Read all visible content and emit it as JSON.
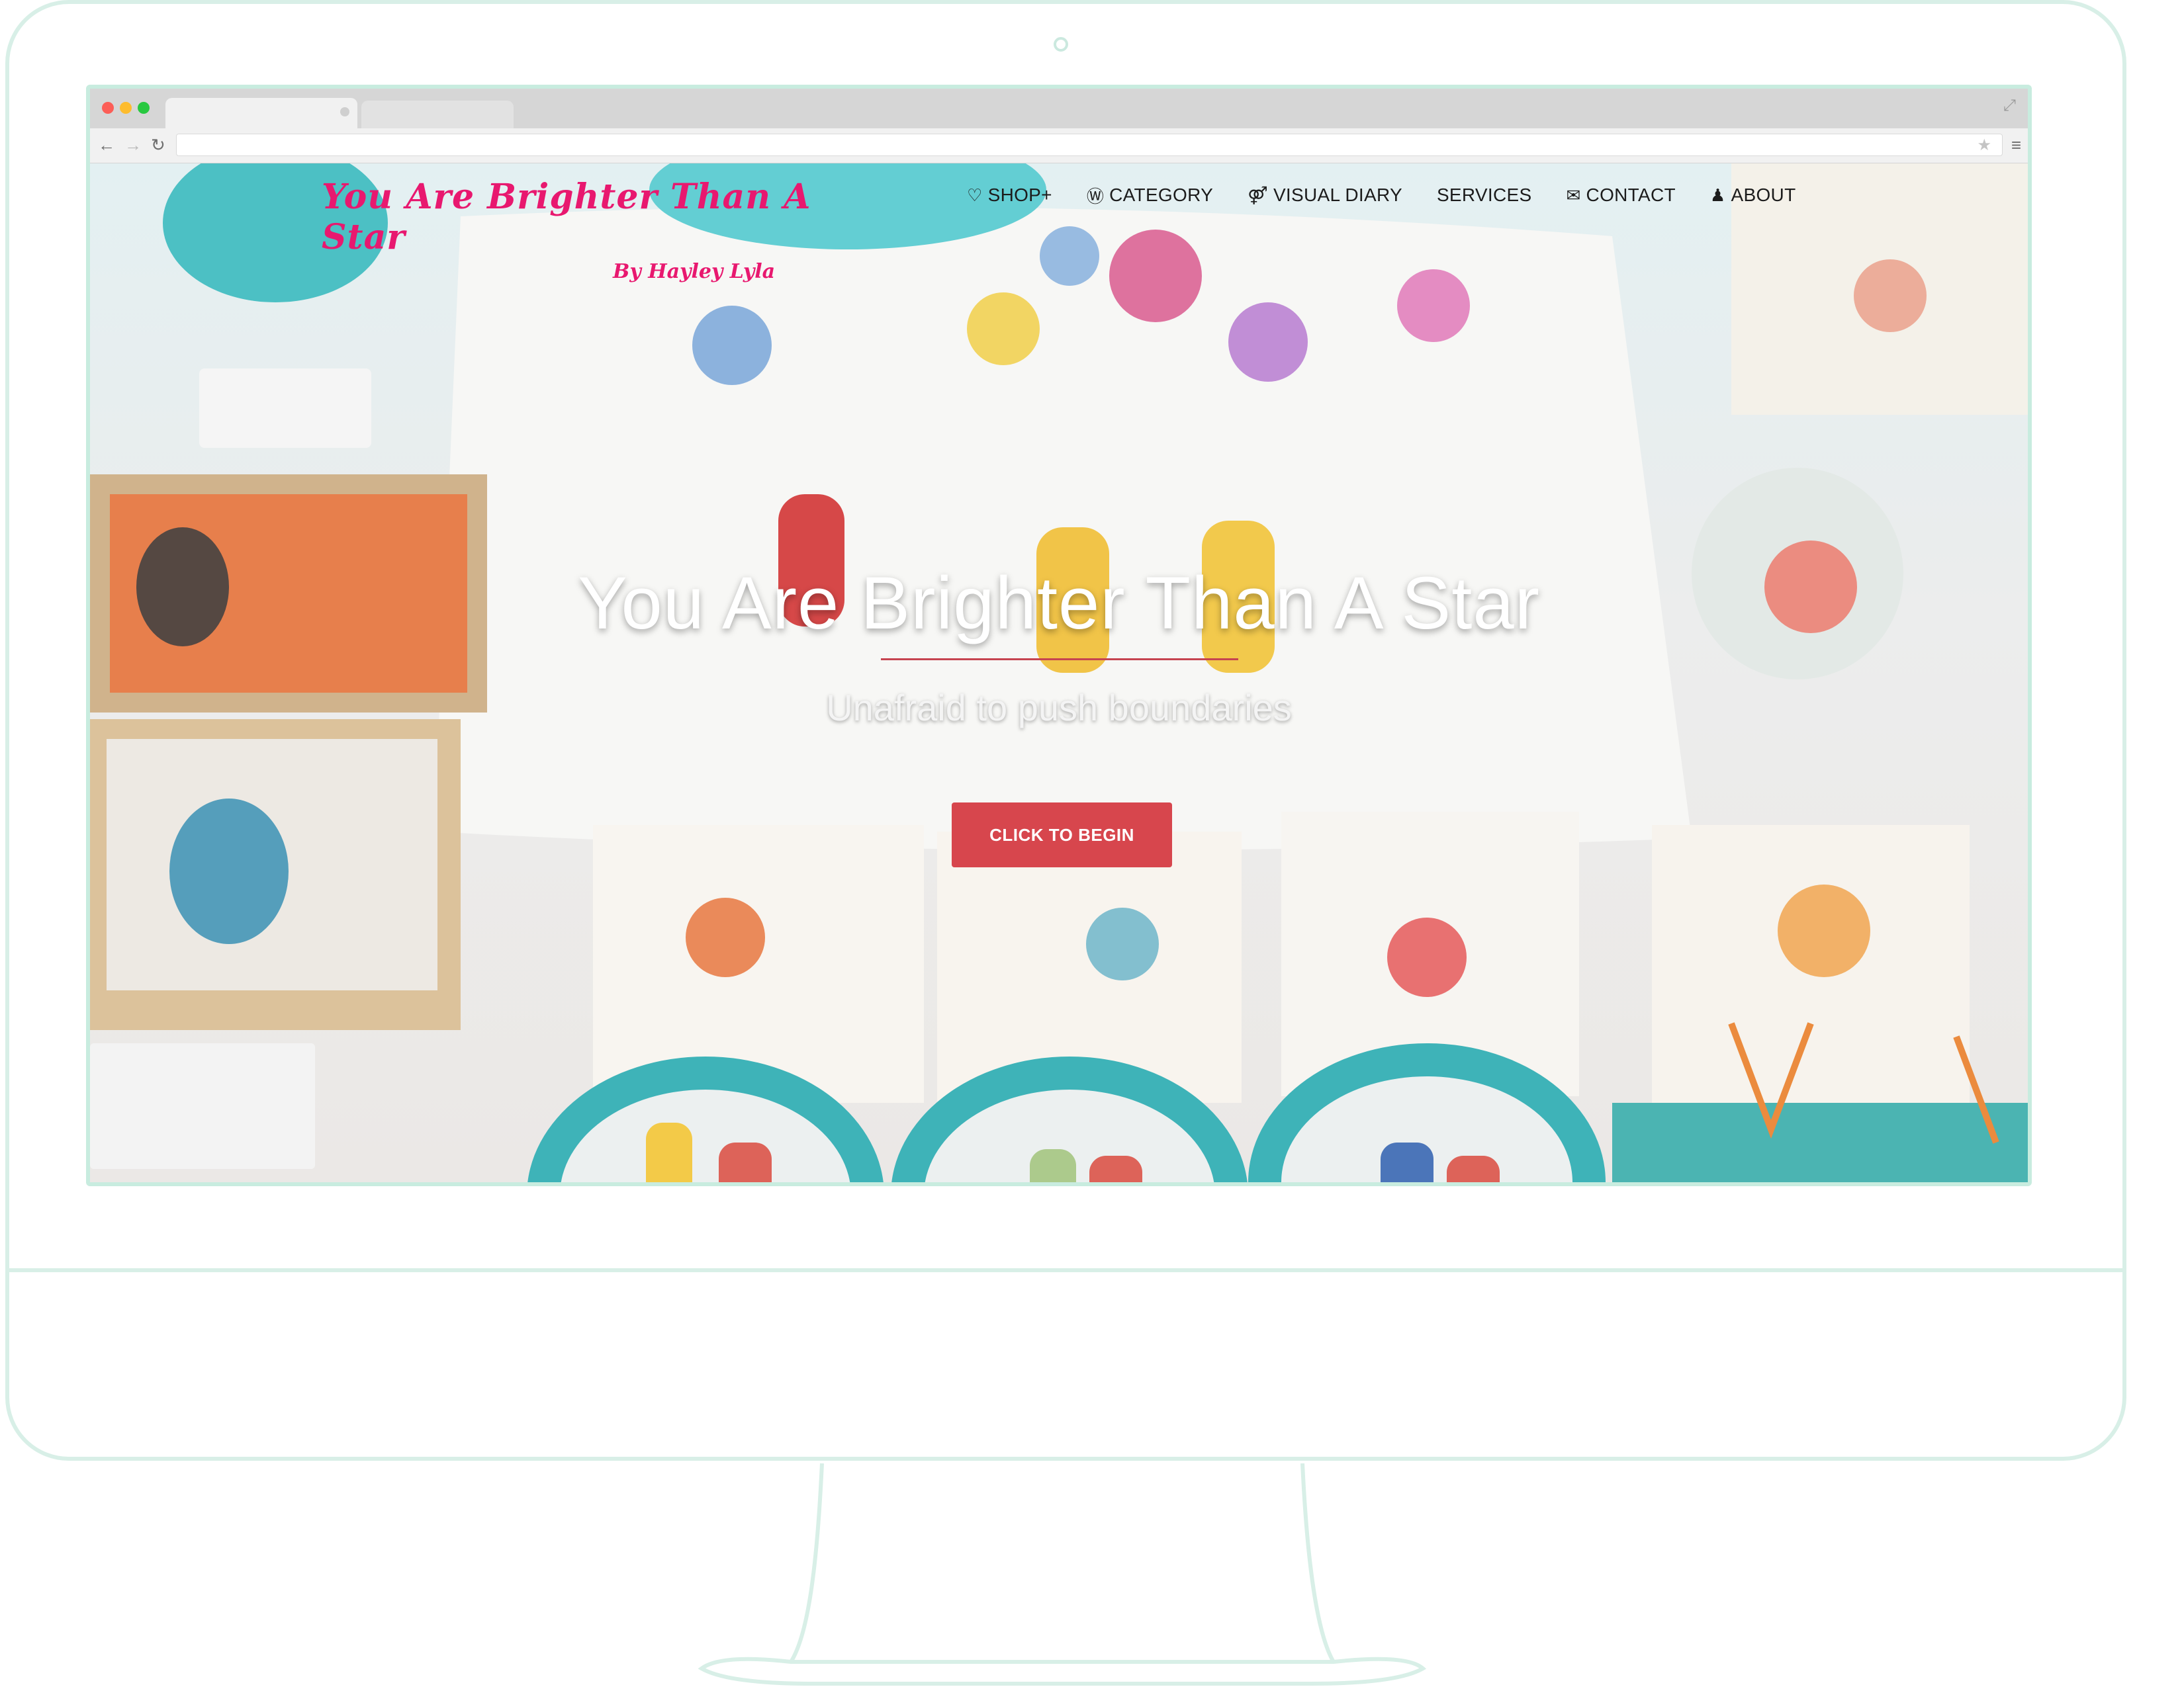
{
  "browser": {
    "url": ""
  },
  "site": {
    "logo_title": "You Are Brighter Than A Star",
    "logo_subtitle": "By Hayley Lyla"
  },
  "nav": {
    "items": [
      {
        "icon": "heart-icon",
        "label": "SHOP+"
      },
      {
        "icon": "wordpress-icon",
        "label": "CATEGORY"
      },
      {
        "icon": "gender-icon",
        "label": "VISUAL DIARY"
      },
      {
        "icon": "",
        "label": "SERVICES"
      },
      {
        "icon": "envelope-icon",
        "label": "CONTACT"
      },
      {
        "icon": "person-icon",
        "label": "ABOUT"
      }
    ]
  },
  "hero": {
    "title": "You Are Brighter Than A Star",
    "subtitle": "Unafraid to push boundaries",
    "cta_label": "CLICK TO BEGIN"
  },
  "colors": {
    "frame_mint": "#d8efe7",
    "logo_pink": "#e8186f",
    "cta_red": "#d7464d",
    "rule_red": "#c64450"
  }
}
